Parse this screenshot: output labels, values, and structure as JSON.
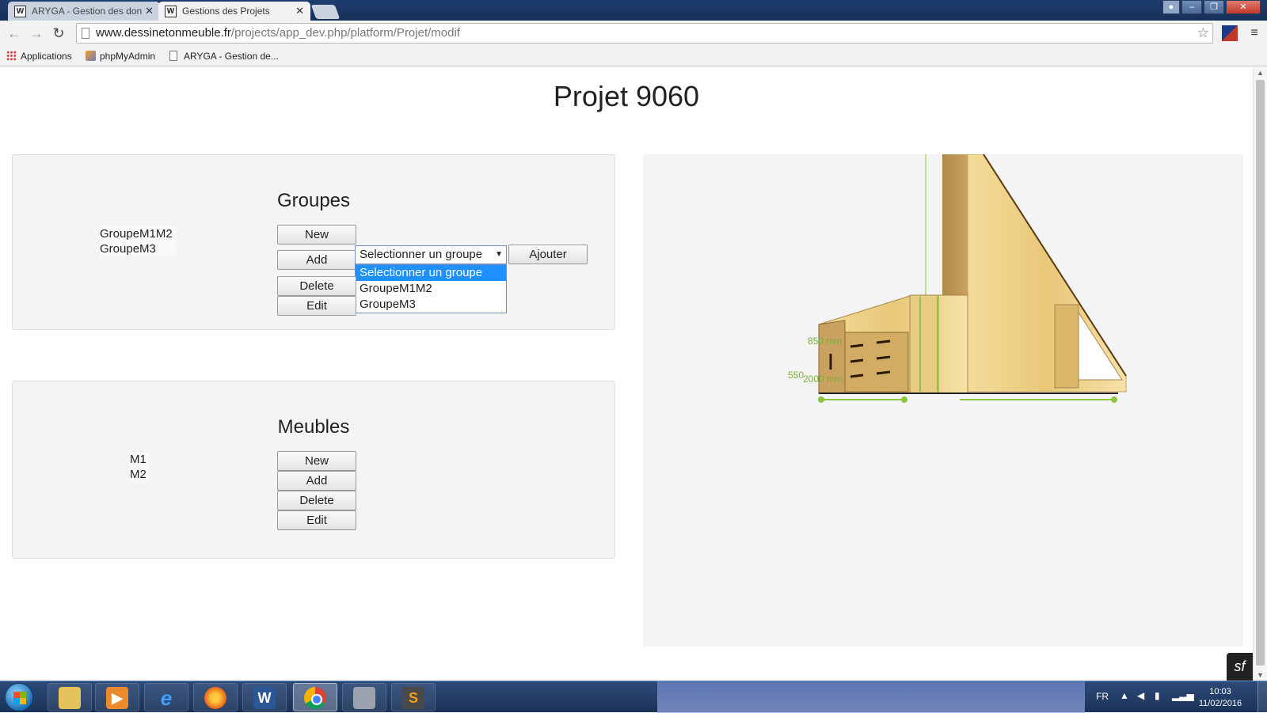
{
  "browser": {
    "tabs": [
      {
        "label": "ARYGA - Gestion des don",
        "favicon": "W"
      },
      {
        "label": "Gestions des Projets",
        "favicon": "W"
      }
    ],
    "url_domain": "www.dessinetonmeuble.fr",
    "url_path": "/projects/app_dev.php/platform/Projet/modif",
    "bookmarks": [
      "Applications",
      "phpMyAdmin",
      "ARYGA - Gestion de..."
    ]
  },
  "page": {
    "title": "Projet 9060",
    "groupes": {
      "title": "Groupes",
      "items": [
        "GroupeM1M2",
        "GroupeM3"
      ],
      "buttons": {
        "new": "New",
        "add": "Add",
        "delete": "Delete",
        "edit": "Edit",
        "ajouter": "Ajouter"
      },
      "select": {
        "value": "Selectionner un groupe",
        "options": [
          "Selectionner un groupe",
          "GroupeM1M2",
          "GroupeM3"
        ]
      }
    },
    "meubles": {
      "title": "Meubles",
      "items": [
        "M1",
        "M2"
      ],
      "buttons": {
        "new": "New",
        "add": "Add",
        "delete": "Delete",
        "edit": "Edit"
      }
    },
    "render": {
      "dimensions": [
        "850 mm",
        "550",
        "2000 mm"
      ]
    },
    "symfony_badge": "sf"
  },
  "taskbar": {
    "apps": [
      "explorer",
      "media-player",
      "internet-explorer",
      "firefox",
      "word",
      "chrome",
      "misc-app",
      "sublime-text"
    ],
    "active_app": "chrome",
    "language": "FR",
    "time": "10:03",
    "date": "11/02/2016"
  },
  "colors": {
    "accent": "#1e90ff",
    "wood": "#e8c878",
    "dimension_green": "#8cc43c"
  }
}
